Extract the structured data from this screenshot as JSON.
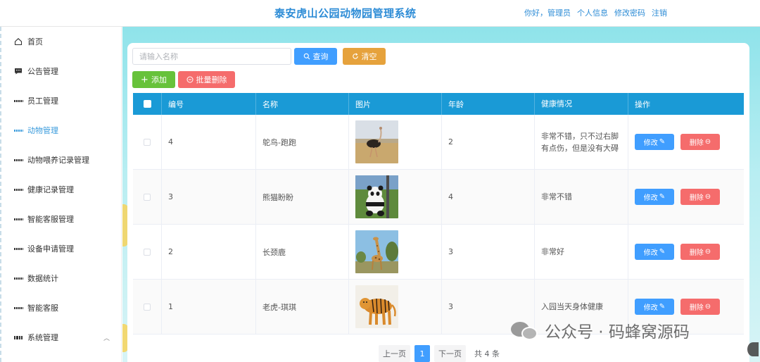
{
  "header": {
    "title": "泰安虎山公园动物园管理系统",
    "links": [
      "你好，管理员",
      "个人信息",
      "修改密码",
      "注销"
    ]
  },
  "sidebar": {
    "items": [
      {
        "label": "首页",
        "icon": "home-icon"
      },
      {
        "label": "公告管理",
        "icon": "message-icon"
      },
      {
        "label": "员工管理",
        "icon": "grid-icon"
      },
      {
        "label": "动物管理",
        "icon": "grid-icon",
        "active": true
      },
      {
        "label": "动物喂养记录管理",
        "icon": "grid-icon"
      },
      {
        "label": "健康记录管理",
        "icon": "grid-icon"
      },
      {
        "label": "智能客服管理",
        "icon": "grid-icon"
      },
      {
        "label": "设备申请管理",
        "icon": "grid-icon"
      },
      {
        "label": "数据统计",
        "icon": "grid-icon"
      },
      {
        "label": "智能客服",
        "icon": "grid-icon"
      },
      {
        "label": "系统管理",
        "icon": "apps-icon",
        "expandable": true
      }
    ]
  },
  "toolbar": {
    "search_placeholder": "请输入名称",
    "query_label": "查询",
    "clear_label": "清空",
    "add_label": "添加",
    "bulk_delete_label": "批量删除"
  },
  "table": {
    "columns": [
      "编号",
      "名称",
      "图片",
      "年龄",
      "健康情况",
      "操作"
    ],
    "rows": [
      {
        "id": "4",
        "name": "鸵鸟-跑跑",
        "image": "ostrich",
        "age": "2",
        "health": "非常不错，只不过右脚有点伤，但是没有大碍"
      },
      {
        "id": "3",
        "name": "熊猫盼盼",
        "image": "panda",
        "age": "4",
        "health": "非常不错"
      },
      {
        "id": "2",
        "name": "长颈鹿",
        "image": "giraffe",
        "age": "3",
        "health": "非常好"
      },
      {
        "id": "1",
        "name": "老虎-琪琪",
        "image": "tiger",
        "age": "3",
        "health": "入园当天身体健康"
      }
    ],
    "edit_label": "修改",
    "delete_label": "删除"
  },
  "pagination": {
    "prev_label": "上一页",
    "current_page": "1",
    "next_label": "下一页",
    "total_label": "共 4 条"
  },
  "watermark": {
    "text": "公众号 · 码蜂窝源码"
  },
  "colors": {
    "primary": "#409eff",
    "header_title": "#2d8cd6",
    "table_head": "#1a9ad6",
    "success": "#67c23a",
    "warning": "#e6a23c",
    "danger": "#f56c6c"
  }
}
